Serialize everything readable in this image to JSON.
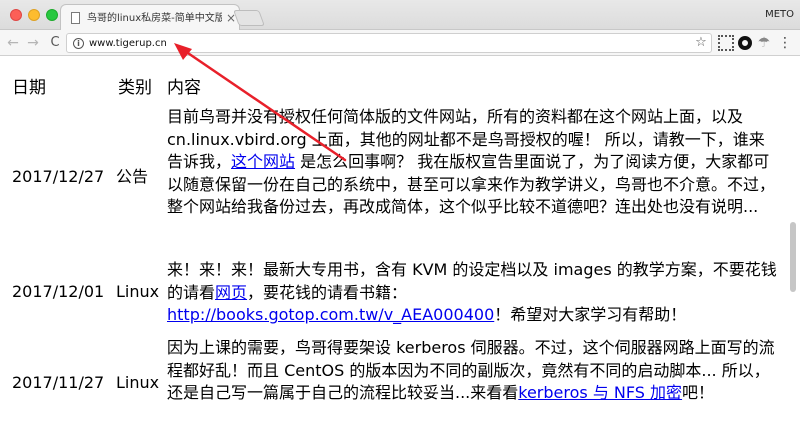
{
  "window": {
    "tab_title": "鸟哥的linux私房菜-简单中文版",
    "tab_close": "×",
    "profile_name": "METO"
  },
  "toolbar": {
    "back_glyph": "←",
    "forward_glyph": "→",
    "reload_glyph": "C",
    "url": "www.tigerup.cn",
    "info_glyph": "i",
    "star_glyph": "☆",
    "menu_glyph": "⋮"
  },
  "table": {
    "headers": {
      "date": "日期",
      "category": "类别",
      "content": "内容"
    },
    "rows": [
      {
        "date": "2017/12/27",
        "category": "公告",
        "text_1": "目前鸟哥并没有授权任何简体版的文件网站，所有的资料都在这个网站上面，以及 cn.linux.vbird.org 上面，其他的网址都不是鸟哥授权的喔！ 所以，请教一下，谁来告诉我，",
        "link_1": "这个网站",
        "text_2": " 是怎么回事啊？ 我在版权宣告里面说了，为了阅读方便，大家都可以随意保留一份在自己的系统中，甚至可以拿来作为教学讲义，鸟哥也不介意。不过， 整个网站给我备份过去，再改成简体，这个似乎比较不道德吧？连出处也没有说明..."
      },
      {
        "date": "2017/12/01",
        "category": "Linux",
        "text_1": "来！来！来！最新大专用书，含有 KVM 的设定档以及 images 的教学方案，不要花钱的请看",
        "link_1": "网页",
        "text_2": "，要花钱的请看书籍：",
        "link_2": "http://books.gotop.com.tw/v_AEA000400",
        "text_3": "！希望对大家学习有帮助！"
      },
      {
        "date": "2017/11/27",
        "category": "Linux",
        "text_1": "因为上课的需要，鸟哥得要架设 kerberos 伺服器。不过，这个伺服器网路上面写的流程都好乱！而且 CentOS 的版本因为不同的副版次，竟然有不同的启动脚本... 所以，还是自己写一篇属于自己的流程比较妥当...来看看",
        "link_1": "kerberos 与 NFS 加密",
        "text_2": "吧！"
      }
    ]
  },
  "colors": {
    "link": "#0000ee",
    "annotation_arrow": "#e8202a"
  },
  "icons": [
    "back-arrow-icon",
    "forward-arrow-icon",
    "reload-icon",
    "info-icon",
    "star-icon",
    "menu-icon"
  ]
}
